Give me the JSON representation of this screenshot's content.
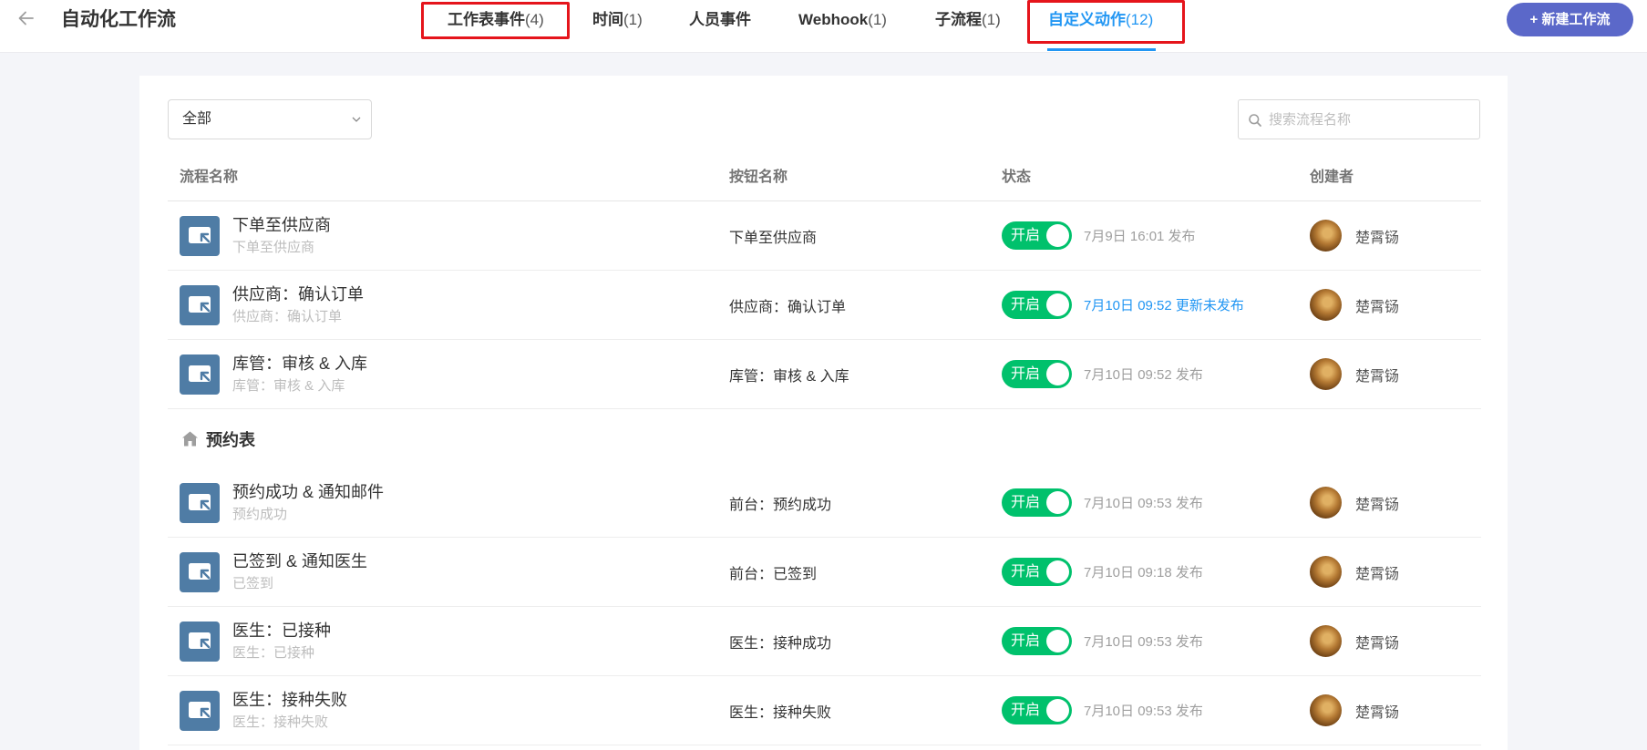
{
  "header": {
    "back_icon": "arrow-left-icon",
    "title": "自动化工作流",
    "new_button": {
      "label": "+ 新建工作流"
    }
  },
  "tabs": [
    {
      "label": "工作表事件",
      "count": "(4)",
      "active": false,
      "highlighted": true
    },
    {
      "label": "时间",
      "count": "(1)",
      "active": false
    },
    {
      "label": "人员事件",
      "count": "",
      "active": false
    },
    {
      "label": "Webhook",
      "count": "(1)",
      "active": false
    },
    {
      "label": "子流程",
      "count": "(1)",
      "active": false
    },
    {
      "label": "自定义动作",
      "count": "(12)",
      "active": true,
      "highlighted": true
    }
  ],
  "filter": {
    "selected": "全部",
    "icon": "chevron-down-icon"
  },
  "search": {
    "placeholder": "搜索流程名称",
    "icon": "search-icon"
  },
  "table": {
    "columns": [
      "流程名称",
      "按钮名称",
      "状态",
      "创建者"
    ],
    "groups": [
      {
        "title": "",
        "rows": [
          {
            "icon": "custom-action-icon",
            "title": "下单至供应商",
            "subtitle": "下单至供应商",
            "button": "下单至供应商",
            "status": "开启",
            "enabled": true,
            "published": "7月9日 16:01 发布",
            "creator": "楚霄铴"
          },
          {
            "icon": "custom-action-icon",
            "title": "供应商：确认订单",
            "subtitle": "供应商：确认订单",
            "button": "供应商：确认订单",
            "status": "开启",
            "enabled": true,
            "published": "7月10日 09:52 更新未发布",
            "unpublished_changes": true,
            "creator": "楚霄铴"
          },
          {
            "icon": "custom-action-icon",
            "title": "库管：审核 & 入库",
            "subtitle": "库管：审核 & 入库",
            "button": "库管：审核 & 入库",
            "status": "开启",
            "enabled": true,
            "published": "7月10日 09:52 发布",
            "creator": "楚霄铴"
          }
        ]
      },
      {
        "title": "预约表",
        "icon": "home-icon",
        "rows": [
          {
            "icon": "custom-action-icon",
            "title": "预约成功 & 通知邮件",
            "subtitle": "预约成功",
            "button": "前台：预约成功",
            "status": "开启",
            "enabled": true,
            "published": "7月10日 09:53 发布",
            "creator": "楚霄铴"
          },
          {
            "icon": "custom-action-icon",
            "title": "已签到 & 通知医生",
            "subtitle": "已签到",
            "button": "前台：已签到",
            "status": "开启",
            "enabled": true,
            "published": "7月10日 09:18 发布",
            "creator": "楚霄铴"
          },
          {
            "icon": "custom-action-icon",
            "title": "医生：已接种",
            "subtitle": "医生：已接种",
            "button": "医生：接种成功",
            "status": "开启",
            "enabled": true,
            "published": "7月10日 09:53 发布",
            "creator": "楚霄铴"
          },
          {
            "icon": "custom-action-icon",
            "title": "医生：接种失败",
            "subtitle": "医生：接种失败",
            "button": "医生：接种失败",
            "status": "开启",
            "enabled": true,
            "published": "7月10日 09:53 发布",
            "creator": "楚霄铴"
          }
        ]
      }
    ]
  },
  "colors": {
    "page_bg": "#f4f5f9",
    "accent": "#2196f3",
    "toggle_on": "#00c16c",
    "new_button": "#5b68c9",
    "icon_tile": "#4f7ca5",
    "annotation": "#e5141b"
  }
}
